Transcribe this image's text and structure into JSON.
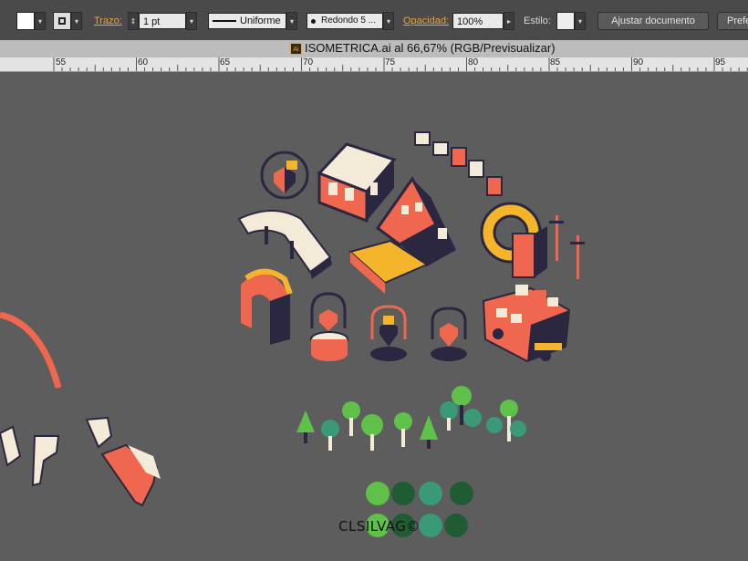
{
  "toolbar": {
    "trazo_label": "Trazo:",
    "stroke_weight": "1 pt",
    "profile": "Uniforme",
    "brush": "Redondo 5 ...",
    "opacity_label": "Opacidad:",
    "opacity_value": "100%",
    "style_label": "Estilo:",
    "fit_button": "Ajustar documento",
    "prefs_button": "Prefe"
  },
  "document": {
    "title": "ISOMETRICA.ai al 66,67% (RGB/Previsualizar)",
    "file_icon_text": "Ai"
  },
  "ruler": {
    "ticks": [
      "55",
      "60",
      "65",
      "70",
      "75",
      "80",
      "85",
      "90",
      "95"
    ]
  },
  "artwork": {
    "credit": "CLSILVAG©",
    "colors": {
      "coral": "#f0674f",
      "navy": "#2b2740",
      "cream": "#f4ead8",
      "yellow": "#f5b52a",
      "green_light": "#5fc04a",
      "green_dark": "#1f5c34",
      "teal": "#3a9a78"
    }
  }
}
